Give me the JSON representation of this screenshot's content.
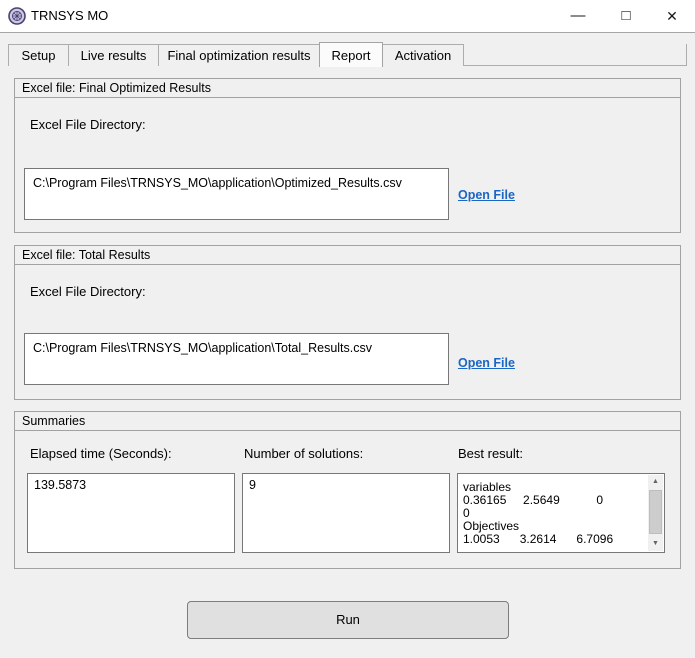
{
  "window": {
    "title": "TRNSYS MO",
    "icons": {
      "minimize": "—",
      "maximize": "□",
      "close": "✕",
      "scroll_up": "▲",
      "scroll_down": "▼"
    }
  },
  "tabs": [
    "Setup",
    "Live results",
    "Final optimization results",
    "Report",
    "Activation"
  ],
  "active_tab": "Report",
  "sections": {
    "final": {
      "title": "Excel file: Final Optimized Results",
      "dir_label": "Excel File Directory:",
      "path": "C:\\Program Files\\TRNSYS_MO\\application\\Optimized_Results.csv",
      "open_link": "Open File"
    },
    "total": {
      "title": "Excel file: Total Results",
      "dir_label": "Excel File Directory:",
      "path": "C:\\Program Files\\TRNSYS_MO\\application\\Total_Results.csv",
      "open_link": "Open File"
    },
    "summaries": {
      "title": "Summaries",
      "elapsed_label": "Elapsed time (Seconds):",
      "elapsed_value": "139.5873",
      "solutions_label": "Number of solutions:",
      "solutions_value": "9",
      "best_label": "Best result:",
      "best_lines": [
        "",
        "variables",
        "0.36165     2.5649           0",
        "0",
        "Objectives",
        "1.0053      3.2614      6.7096"
      ]
    }
  },
  "run_button_label": "Run",
  "colors": {
    "link_blue": "#1a66c4",
    "panel_gray": "#f0f0f0",
    "border_gray": "#a2a2a2"
  }
}
